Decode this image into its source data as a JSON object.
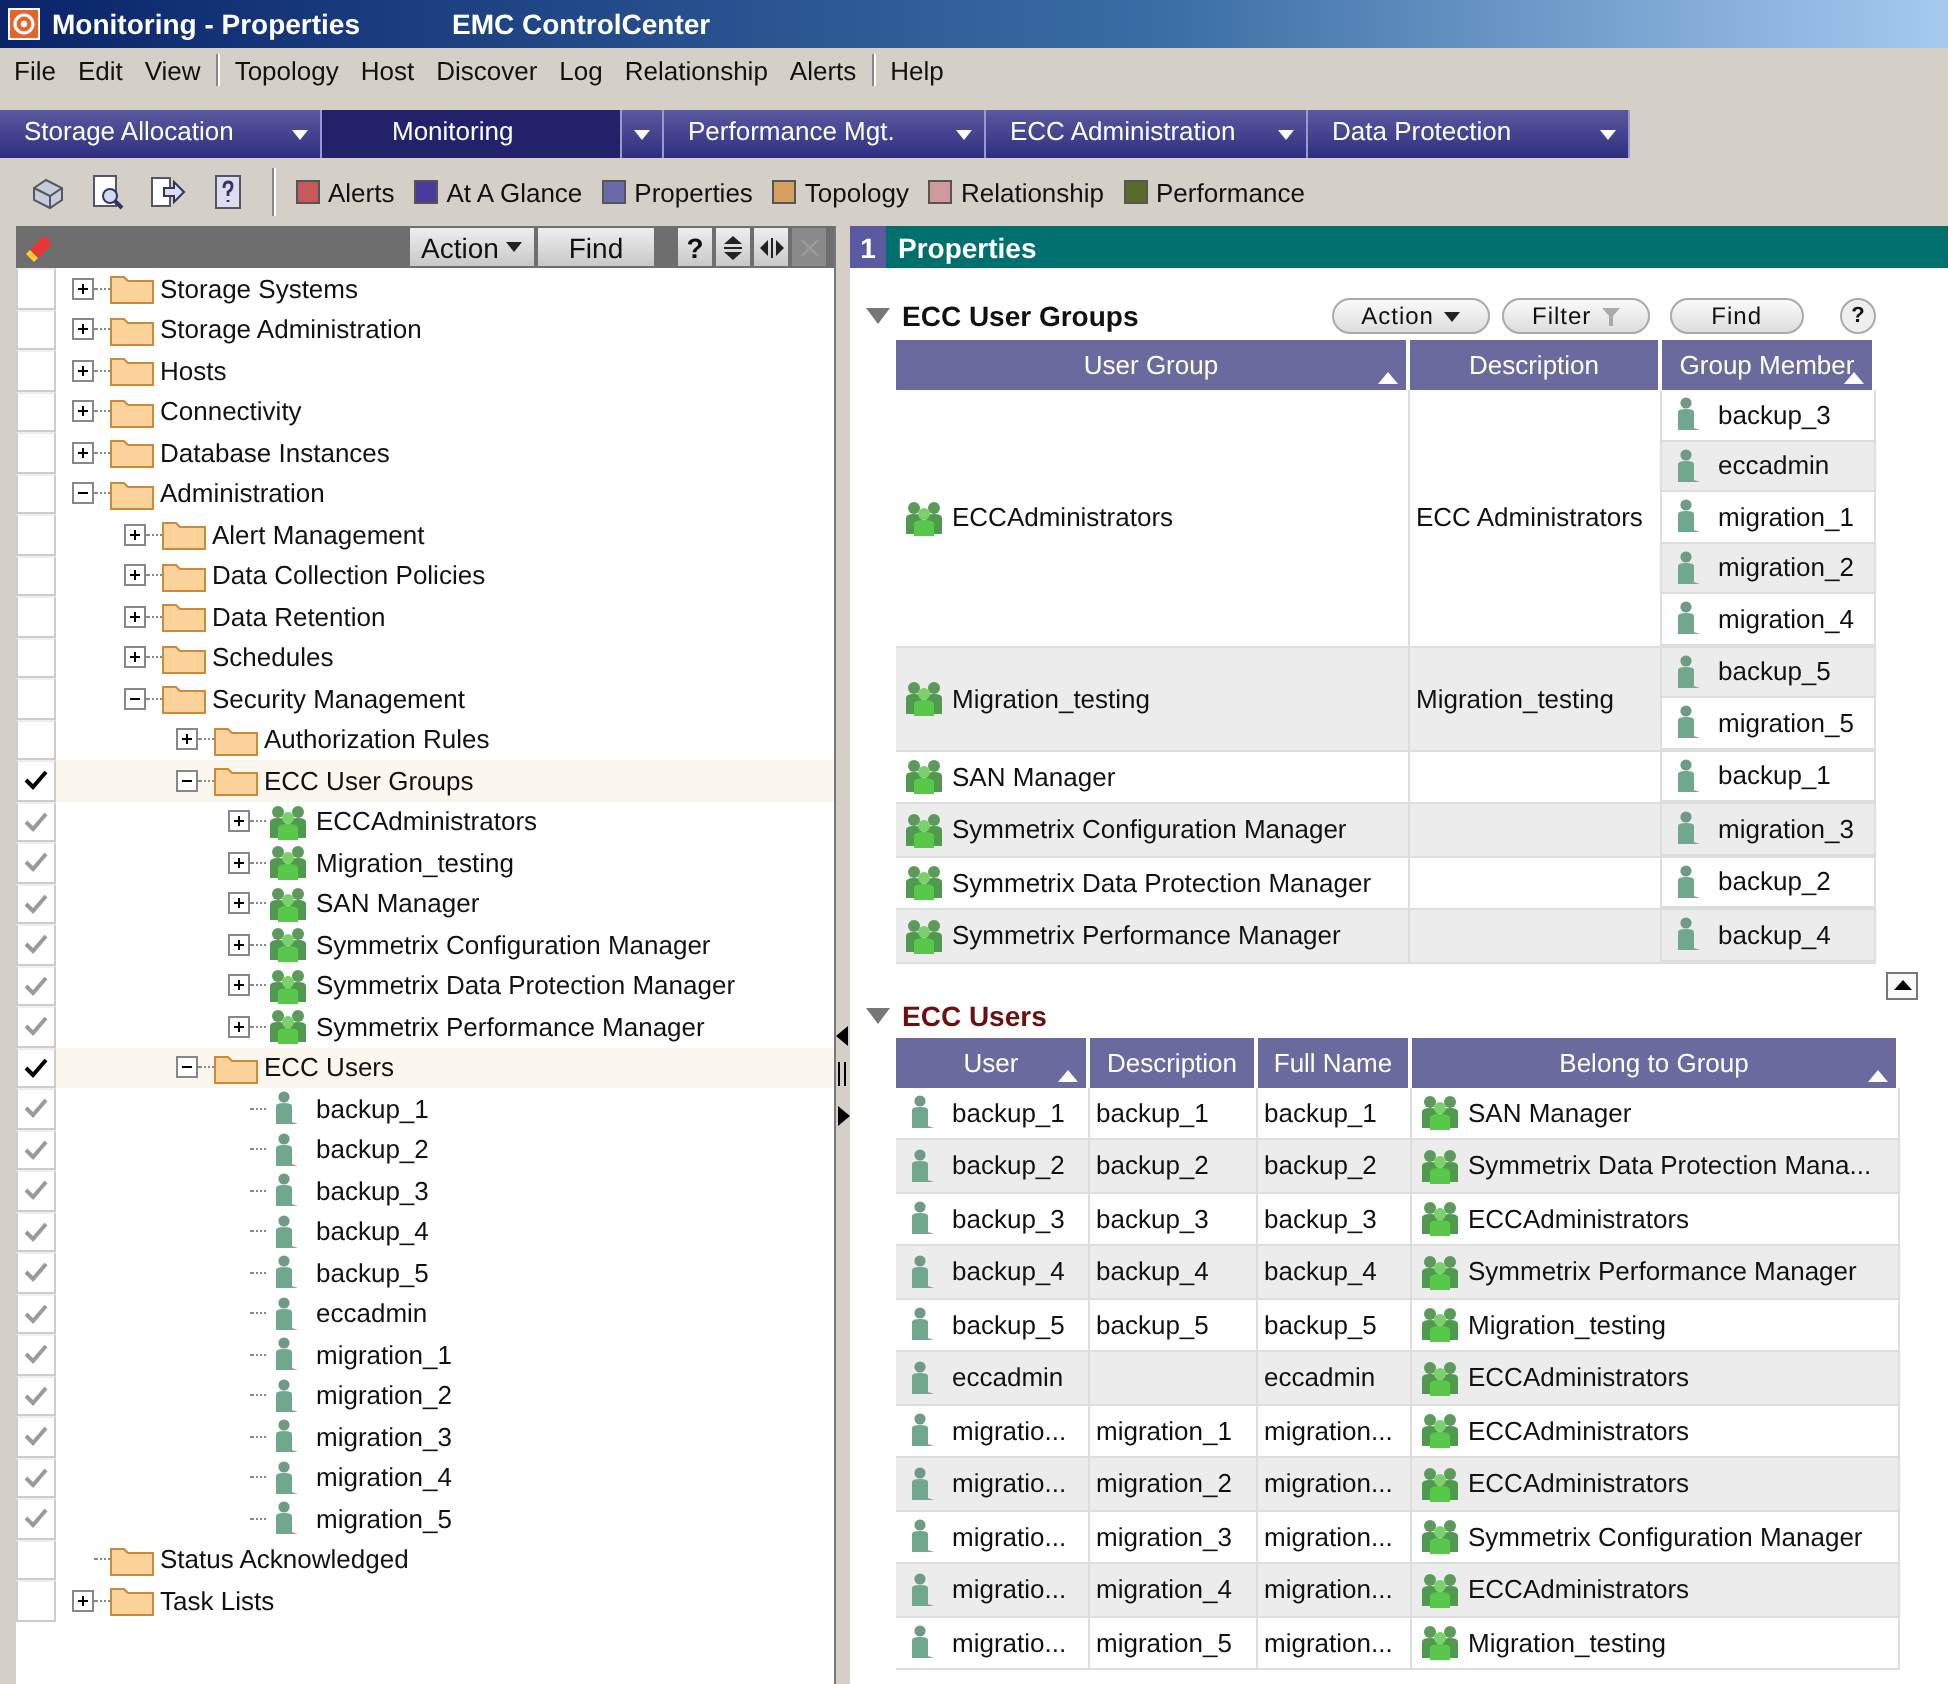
{
  "window": {
    "title": "Monitoring - Properties",
    "app_name": "EMC ControlCenter"
  },
  "menu": [
    [
      "File",
      "Edit",
      "View"
    ],
    [
      "Topology",
      "Host",
      "Discover",
      "Log",
      "Relationship",
      "Alerts"
    ],
    [
      "Help"
    ]
  ],
  "nav_tabs": [
    {
      "label": "Storage Allocation",
      "selected": false
    },
    {
      "label": "Monitoring",
      "selected": true
    },
    {
      "label": "Performance Mgt.",
      "selected": false
    },
    {
      "label": "ECC Administration",
      "selected": false
    },
    {
      "label": "Data Protection",
      "selected": false
    }
  ],
  "legend": [
    {
      "label": "Alerts",
      "color": "#c65a5a"
    },
    {
      "label": "At A Glance",
      "color": "#4a3a9a"
    },
    {
      "label": "Properties",
      "color": "#6a6aaa"
    },
    {
      "label": "Topology",
      "color": "#d8a060"
    },
    {
      "label": "Relationship",
      "color": "#d09a9a"
    },
    {
      "label": "Performance",
      "color": "#5a6a2a"
    }
  ],
  "tree_panel": {
    "buttons": [
      "Action",
      "Find"
    ],
    "help": "?"
  },
  "tree": [
    {
      "label": "Storage Systems",
      "kind": "folder",
      "expanded": false,
      "checked": false,
      "selected": false
    },
    {
      "label": "Storage Administration",
      "kind": "folder",
      "expanded": false,
      "checked": false,
      "selected": false
    },
    {
      "label": "Hosts",
      "kind": "folder",
      "expanded": false,
      "checked": false,
      "selected": false
    },
    {
      "label": "Connectivity",
      "kind": "folder",
      "expanded": false,
      "checked": false,
      "selected": false
    },
    {
      "label": "Database Instances",
      "kind": "folder",
      "expanded": false,
      "checked": false,
      "selected": false
    },
    {
      "label": "Administration",
      "kind": "folder",
      "expanded": true,
      "checked": false,
      "selected": false,
      "children": [
        {
          "label": "Alert Management",
          "kind": "folder",
          "expanded": false,
          "checked": false,
          "selected": false
        },
        {
          "label": "Data Collection Policies",
          "kind": "folder",
          "expanded": false,
          "checked": false,
          "selected": false
        },
        {
          "label": "Data Retention",
          "kind": "folder",
          "expanded": false,
          "checked": false,
          "selected": false
        },
        {
          "label": "Schedules",
          "kind": "folder",
          "expanded": false,
          "checked": false,
          "selected": false
        },
        {
          "label": "Security Management",
          "kind": "folder",
          "expanded": true,
          "checked": false,
          "selected": false,
          "children": [
            {
              "label": "Authorization Rules",
              "kind": "folder",
              "expanded": false,
              "checked": false,
              "selected": false
            },
            {
              "label": "ECC User Groups",
              "kind": "folder",
              "expanded": true,
              "checked": true,
              "selected": true,
              "children": [
                {
                  "label": "ECCAdministrators",
                  "kind": "group",
                  "expanded": false,
                  "checked": true,
                  "selected": false
                },
                {
                  "label": "Migration_testing",
                  "kind": "group",
                  "expanded": false,
                  "checked": true,
                  "selected": false
                },
                {
                  "label": "SAN Manager",
                  "kind": "group",
                  "expanded": false,
                  "checked": true,
                  "selected": false
                },
                {
                  "label": "Symmetrix Configuration Manager",
                  "kind": "group",
                  "expanded": false,
                  "checked": true,
                  "selected": false
                },
                {
                  "label": "Symmetrix Data Protection Manager",
                  "kind": "group",
                  "expanded": false,
                  "checked": true,
                  "selected": false
                },
                {
                  "label": "Symmetrix Performance Manager",
                  "kind": "group",
                  "expanded": false,
                  "checked": true,
                  "selected": false
                }
              ]
            },
            {
              "label": "ECC Users",
              "kind": "folder",
              "expanded": true,
              "checked": true,
              "selected": true,
              "children": [
                {
                  "label": "backup_1",
                  "kind": "user",
                  "checked": true,
                  "selected": false
                },
                {
                  "label": "backup_2",
                  "kind": "user",
                  "checked": true,
                  "selected": false
                },
                {
                  "label": "backup_3",
                  "kind": "user",
                  "checked": true,
                  "selected": false
                },
                {
                  "label": "backup_4",
                  "kind": "user",
                  "checked": true,
                  "selected": false
                },
                {
                  "label": "backup_5",
                  "kind": "user",
                  "checked": true,
                  "selected": false
                },
                {
                  "label": "eccadmin",
                  "kind": "user",
                  "checked": true,
                  "selected": false
                },
                {
                  "label": "migration_1",
                  "kind": "user",
                  "checked": true,
                  "selected": false
                },
                {
                  "label": "migration_2",
                  "kind": "user",
                  "checked": true,
                  "selected": false
                },
                {
                  "label": "migration_3",
                  "kind": "user",
                  "checked": true,
                  "selected": false
                },
                {
                  "label": "migration_4",
                  "kind": "user",
                  "checked": true,
                  "selected": false
                },
                {
                  "label": "migration_5",
                  "kind": "user",
                  "checked": true,
                  "selected": false
                }
              ]
            }
          ]
        }
      ]
    },
    {
      "label": "Status Acknowledged",
      "kind": "folder",
      "checked": false,
      "selected": false
    },
    {
      "label": "Task Lists",
      "kind": "folder",
      "expanded": false,
      "checked": false,
      "selected": false
    }
  ],
  "properties": {
    "index": "1",
    "title": "Properties",
    "user_groups": {
      "title": "ECC User Groups",
      "buttons": [
        "Action",
        "Filter",
        "Find"
      ],
      "help": "?",
      "columns": [
        {
          "label": "User Group",
          "sorted": true
        },
        {
          "label": "Description",
          "sorted": false
        },
        {
          "label": "Group Member",
          "sorted": true
        }
      ],
      "rows": [
        {
          "group": "ECCAdministrators",
          "description": "ECC Administrators",
          "members": [
            "backup_3",
            "eccadmin",
            "migration_1",
            "migration_2",
            "migration_4"
          ]
        },
        {
          "group": "Migration_testing",
          "description": "Migration_testing",
          "members": [
            "backup_5",
            "migration_5"
          ]
        },
        {
          "group": "SAN Manager",
          "members": [
            "backup_1"
          ]
        },
        {
          "group": "Symmetrix Configuration Manager",
          "members": [
            "migration_3"
          ]
        },
        {
          "group": "Symmetrix Data Protection Manager",
          "members": [
            "backup_2"
          ]
        },
        {
          "group": "Symmetrix Performance Manager",
          "members": [
            "backup_4"
          ]
        }
      ]
    },
    "users": {
      "title": "ECC Users",
      "columns": [
        {
          "label": "User",
          "sorted": true
        },
        {
          "label": "Description",
          "sorted": false
        },
        {
          "label": "Full Name",
          "sorted": false
        },
        {
          "label": "Belong to Group",
          "sorted": true
        }
      ],
      "rows": [
        {
          "user": "backup_1",
          "description": "backup_1",
          "full_name": "backup_1",
          "group": "SAN Manager"
        },
        {
          "user": "backup_2",
          "description": "backup_2",
          "full_name": "backup_2",
          "group": "Symmetrix Data Protection Mana..."
        },
        {
          "user": "backup_3",
          "description": "backup_3",
          "full_name": "backup_3",
          "group": "ECCAdministrators"
        },
        {
          "user": "backup_4",
          "description": "backup_4",
          "full_name": "backup_4",
          "group": "Symmetrix Performance Manager"
        },
        {
          "user": "backup_5",
          "description": "backup_5",
          "full_name": "backup_5",
          "group": "Migration_testing"
        },
        {
          "user": "eccadmin",
          "full_name": "eccadmin",
          "group": "ECCAdministrators"
        },
        {
          "user": "migratio...",
          "description": "migration_1",
          "full_name": "migration...",
          "group": "ECCAdministrators"
        },
        {
          "user": "migratio...",
          "description": "migration_2",
          "full_name": "migration...",
          "group": "ECCAdministrators"
        },
        {
          "user": "migratio...",
          "description": "migration_3",
          "full_name": "migration...",
          "group": "Symmetrix Configuration Manager"
        },
        {
          "user": "migratio...",
          "description": "migration_4",
          "full_name": "migration...",
          "group": "ECCAdministrators"
        },
        {
          "user": "migratio...",
          "description": "migration_5",
          "full_name": "migration...",
          "group": "Migration_testing"
        }
      ]
    }
  }
}
